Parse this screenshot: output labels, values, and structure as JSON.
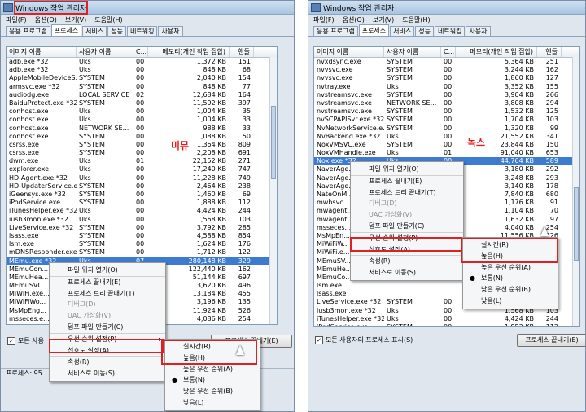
{
  "left": {
    "title": "Windows 작업 관리자",
    "menu": [
      "파일(F)",
      "옵션(O)",
      "보기(V)",
      "도움말(H)"
    ],
    "tabs": [
      "응용 프로그램",
      "프로세스",
      "서비스",
      "성능",
      "네트워킹",
      "사용자"
    ],
    "columns": [
      "이미지 이름",
      "사용자 이름",
      "C...",
      "메모리(개인 작업 집합)",
      "핸들"
    ],
    "rows": [
      [
        "adb.exe *32",
        "Uks",
        "00",
        "1,372 KB",
        "151"
      ],
      [
        "adb.exe *32",
        "Uks",
        "00",
        "848 KB",
        "68"
      ],
      [
        "AppleMobileDeviceS...",
        "SYSTEM",
        "00",
        "2,040 KB",
        "154"
      ],
      [
        "armsvc.exe *32",
        "SYSTEM",
        "00",
        "848 KB",
        "77"
      ],
      [
        "audiodg.exe",
        "LOCAL SERVICE",
        "02",
        "12,684 KB",
        "164"
      ],
      [
        "BaiduProtect.exe *32",
        "SYSTEM",
        "00",
        "11,592 KB",
        "397"
      ],
      [
        "conhost.exe",
        "Uks",
        "00",
        "1,004 KB",
        "35"
      ],
      [
        "conhost.exe",
        "Uks",
        "00",
        "1,004 KB",
        "33"
      ],
      [
        "conhost.exe",
        "NETWORK SE...",
        "00",
        "988 KB",
        "33"
      ],
      [
        "conhost.exe",
        "SYSTEM",
        "00",
        "1,088 KB",
        "50"
      ],
      [
        "csrss.exe",
        "SYSTEM",
        "00",
        "1,364 KB",
        "809"
      ],
      [
        "csrss.exe",
        "SYSTEM",
        "00",
        "2,208 KB",
        "691"
      ],
      [
        "dwm.exe",
        "Uks",
        "01",
        "22,152 KB",
        "271"
      ],
      [
        "explorer.exe",
        "Uks",
        "00",
        "17,240 KB",
        "747"
      ],
      [
        "HD-Agent.exe *32",
        "Uks",
        "00",
        "11,228 KB",
        "749"
      ],
      [
        "HD-UpdaterService.e...",
        "SYSTEM",
        "00",
        "2,464 KB",
        "238"
      ],
      [
        "iGeensys.exe *32",
        "SYSTEM",
        "00",
        "1,460 KB",
        "69"
      ],
      [
        "iPodService.exe",
        "SYSTEM",
        "00",
        "1,888 KB",
        "112"
      ],
      [
        "iTunesHelper.exe *32",
        "Uks",
        "00",
        "4,424 KB",
        "244"
      ],
      [
        "iusb3mon.exe *32",
        "Uks",
        "00",
        "1,568 KB",
        "103"
      ],
      [
        "LiveService.exe *32",
        "SYSTEM",
        "00",
        "3,792 KB",
        "285"
      ],
      [
        "lsass.exe",
        "SYSTEM",
        "00",
        "4,588 KB",
        "854"
      ],
      [
        "lsm.exe",
        "SYSTEM",
        "00",
        "1,624 KB",
        "176"
      ],
      [
        "mDNSResponder.exe",
        "SYSTEM",
        "00",
        "1,712 KB",
        "122"
      ],
      [
        "MEmu.exe *32",
        "Uks",
        "07",
        "280,148 KB",
        "329"
      ],
      [
        "MEmuCon...",
        "",
        "",
        "122,440 KB",
        "162"
      ],
      [
        "MEmuHea...",
        "",
        "",
        "51,144 KB",
        "697"
      ],
      [
        "MEmuSVC...",
        "",
        "",
        "3,620 KB",
        "496"
      ],
      [
        "MiWiFi.exe...",
        "",
        "",
        "13,184 KB",
        "455"
      ],
      [
        "MiWiFiWo...",
        "",
        "",
        "3,196 KB",
        "135"
      ],
      [
        "MsMpEng...",
        "",
        "",
        "11,924 KB",
        "526"
      ],
      [
        "msseces.e...",
        "",
        "",
        "4,086 KB",
        "254"
      ]
    ],
    "selected_row": 24,
    "annotation": "미뮤",
    "context_menu": [
      "파일 위치 열기(O)",
      "프로세스 끝내기(E)",
      "프로세스 트리 끝내기(T)",
      "디버그(D)",
      "UAC 가상화(V)",
      "덤프 파일 만들기(C)",
      "우선 순위 설정(P)",
      "선호도 설정(A)...",
      "속성(R)",
      "서비스로 이동(S)"
    ],
    "submenu": [
      "실시간(R)",
      "높음(H)",
      "높은 우선 순위(A)",
      "보통(N)",
      "낮은 우선 순위(B)",
      "낮음(L)"
    ],
    "show_all_label": "모든 사용",
    "end_button": "프로세스 끝내기(E)",
    "status": "프로세스: 95"
  },
  "right": {
    "title": "Windows 작업 관리자",
    "menu": [
      "파일(F)",
      "옵션(O)",
      "보기(V)",
      "도움말(H)"
    ],
    "tabs": [
      "응용 프로그램",
      "프로세스",
      "서비스",
      "성능",
      "네트워킹",
      "사용자"
    ],
    "columns": [
      "이미지 이름",
      "사용자 이름",
      "C...",
      "메모리(개인 작업 집합)",
      "핸들"
    ],
    "rows": [
      [
        "nvxdsync.exe",
        "SYSTEM",
        "00",
        "5,364 KB",
        "251"
      ],
      [
        "nvvsvc.exe",
        "SYSTEM",
        "00",
        "3,244 KB",
        "162"
      ],
      [
        "nvvsvc.exe",
        "SYSTEM",
        "00",
        "1,860 KB",
        "127"
      ],
      [
        "nvtray.exe",
        "Uks",
        "00",
        "3,352 KB",
        "155"
      ],
      [
        "nvstreamsvc.exe",
        "SYSTEM",
        "00",
        "3,904 KB",
        "266"
      ],
      [
        "nvstreamsvc.exe",
        "NETWORK SE...",
        "00",
        "3,808 KB",
        "294"
      ],
      [
        "nvstreamsvc.exe",
        "SYSTEM",
        "00",
        "1,532 KB",
        "125"
      ],
      [
        "nvSCPAPISvr.exe *32",
        "SYSTEM",
        "00",
        "1,704 KB",
        "103"
      ],
      [
        "NvNetworkService.e...",
        "SYSTEM",
        "00",
        "1,320 KB",
        "99"
      ],
      [
        "NvBackend.exe *32",
        "Uks",
        "00",
        "21,552 KB",
        "341"
      ],
      [
        "NoxVMSVC.exe",
        "SYSTEM",
        "00",
        "23,844 KB",
        "150"
      ],
      [
        "NoxVMHandle.exe",
        "Uks",
        "01",
        "91,040 KB",
        "653"
      ],
      [
        "Nox.exe *32",
        "Uks",
        "00",
        "44,764 KB",
        "589"
      ],
      [
        "NaverAge...",
        "",
        "",
        "3,180 KB",
        "292"
      ],
      [
        "NaverAge...",
        "",
        "",
        "3,248 KB",
        "293"
      ],
      [
        "NaverAge...",
        "",
        "",
        "3,140 KB",
        "178"
      ],
      [
        "NateOnM...",
        "",
        "",
        "7,840 KB",
        "680"
      ],
      [
        "mwbsvc...",
        "",
        "",
        "1,176 KB",
        "91"
      ],
      [
        "mwagent...",
        "",
        "",
        "1,104 KB",
        "70"
      ],
      [
        "mwagent...",
        "",
        "",
        "1,632 KB",
        "97"
      ],
      [
        "msseces...",
        "",
        "",
        "4,040 KB",
        "254"
      ],
      [
        "MsMpEn...",
        "",
        "",
        "11,556 KB",
        "526"
      ],
      [
        "MiWiFiW...",
        "",
        "",
        "3,196 KB",
        "135"
      ],
      [
        "MiWiFi.e...",
        "",
        "",
        "13,184 KB",
        "455"
      ],
      [
        "MEmuSV...",
        "",
        "",
        "3,632 KB",
        "496"
      ],
      [
        "MEmuHe...",
        "",
        "",
        "51,200 KB",
        "697"
      ],
      [
        "MEmuCo...",
        "",
        "",
        "122,448 KB",
        "162"
      ],
      [
        "lsm.exe",
        "",
        "",
        "1,624 KB",
        "176"
      ],
      [
        "lsass.exe",
        "",
        "",
        "4,568 KB",
        "999"
      ],
      [
        "LiveService.exe *32",
        "SYSTEM",
        "00",
        "3,792 KB",
        "285"
      ],
      [
        "iusb3mon.exe *32",
        "Uks",
        "00",
        "1,568 KB",
        "103"
      ],
      [
        "iTunesHelper.exe *32",
        "Uks",
        "00",
        "4,424 KB",
        "244"
      ],
      [
        "iPodService.exe",
        "SYSTEM",
        "00",
        "1,852 KB",
        "112"
      ]
    ],
    "selected_row": 12,
    "annotation": "녹스",
    "context_menu": [
      "파일 위치 열기(O)",
      "프로세스 끝내기(E)",
      "프로세스 트리 끝내기(T)",
      "디버그(D)",
      "UAC 가상화(V)",
      "덤프 파일 만들기(C)",
      "우선 순위 설정(P)",
      "선호도 설정(A)...",
      "속성(R)",
      "서비스로 이동(S)"
    ],
    "submenu": [
      "실시간(R)",
      "높음(H)",
      "높은 우선 순위(A)",
      "보통(N)",
      "낮은 우선 순위(B)",
      "낮음(L)"
    ],
    "show_all_label": "모든 사용자의 프로세스 표시(S)",
    "end_button": "프로세스 끝내기(E)"
  }
}
